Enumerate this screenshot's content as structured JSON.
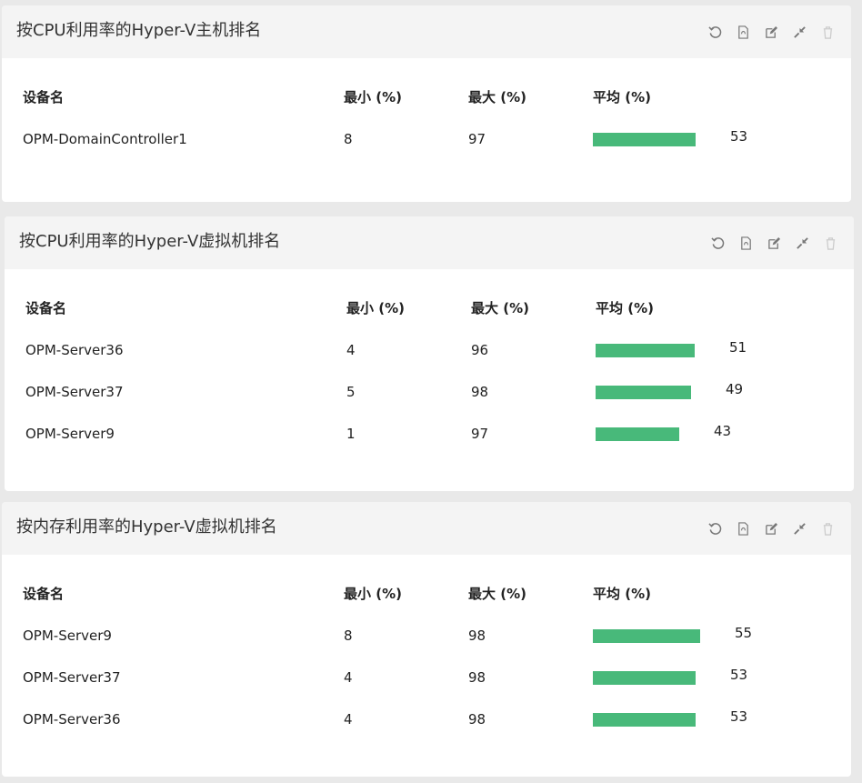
{
  "toolbar_icons": [
    "refresh-icon",
    "export-pdf-icon",
    "edit-icon",
    "minimize-icon",
    "delete-icon"
  ],
  "accent_color": "#48b97a",
  "columns": {
    "name": "设备名",
    "min": "最小 (%)",
    "max": "最大 (%)",
    "avg": "平均 (%)"
  },
  "widgets": [
    {
      "title": "按CPU利用率的Hyper-V主机排名",
      "rows": [
        {
          "name": "OPM-DomainController1",
          "min": "8",
          "max": "97",
          "avg": "53",
          "avg_pct": 53
        }
      ]
    },
    {
      "title": "按CPU利用率的Hyper-V虚拟机排名",
      "rows": [
        {
          "name": "OPM-Server36",
          "min": "4",
          "max": "96",
          "avg": "51",
          "avg_pct": 51
        },
        {
          "name": "OPM-Server37",
          "min": "5",
          "max": "98",
          "avg": "49",
          "avg_pct": 49
        },
        {
          "name": "OPM-Server9",
          "min": "1",
          "max": "97",
          "avg": "43",
          "avg_pct": 43
        }
      ]
    },
    {
      "title": "按内存利用率的Hyper-V虚拟机排名",
      "rows": [
        {
          "name": "OPM-Server9",
          "min": "8",
          "max": "98",
          "avg": "55",
          "avg_pct": 55
        },
        {
          "name": "OPM-Server37",
          "min": "4",
          "max": "98",
          "avg": "53",
          "avg_pct": 53
        },
        {
          "name": "OPM-Server36",
          "min": "4",
          "max": "98",
          "avg": "53",
          "avg_pct": 53
        }
      ]
    }
  ]
}
